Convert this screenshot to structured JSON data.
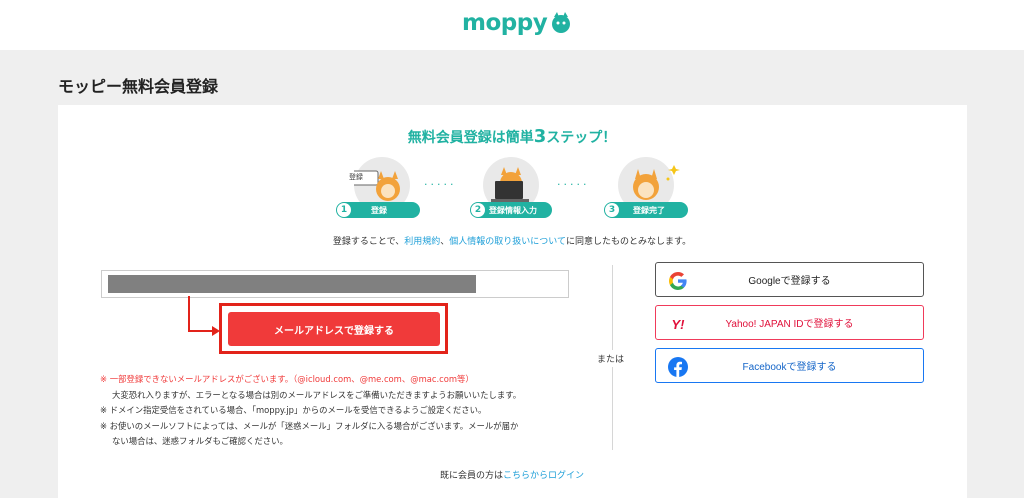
{
  "header": {
    "logo_text": "moppy"
  },
  "page_title": "モッピー無料会員登録",
  "steps": {
    "title_prefix": "無料会員登録は簡単",
    "title_num": "3",
    "title_suffix": "ステップ！",
    "items": [
      {
        "num": "1",
        "label": "登録",
        "card_text": "登録"
      },
      {
        "num": "2",
        "label": "登録情報入力"
      },
      {
        "num": "3",
        "label": "登録完了"
      }
    ],
    "dots": "·····"
  },
  "agreement": {
    "prefix": "登録することで、",
    "terms_link": "利用規約",
    "sep": "、",
    "privacy_link": "個人情報の取り扱いについて",
    "suffix": "に同意したものとみなします。"
  },
  "email_button_label": "メールアドレスで登録する",
  "notes": {
    "line1_mark": "※",
    "line1_red": "一部登録できないメールアドレスがございます。（@icloud.com、@me.com、@mac.com等）",
    "line1_cont": "大変恐れ入りますが、エラーとなる場合は別のメールアドレスをご準備いただきますようお願いいたします。",
    "line2": "※ ドメイン指定受信をされている場合、「moppy.jp」からのメールを受信できるようご設定ください。",
    "line3": "※ お使いのメールソフトによっては、メールが「迷惑メール」フォルダに入る場合がございます。メールが届か",
    "line3_cont": "ない場合は、迷惑フォルダもご確認ください。"
  },
  "or_text": "または",
  "sns": {
    "google_label": "Googleで登録する",
    "yahoo_label": "Yahoo! JAPAN IDで登録する",
    "yahoo_icon_text": "Y!",
    "facebook_label": "Facebookで登録する"
  },
  "login": {
    "prefix": "既に会員の方は",
    "link": "こちらからログイン"
  },
  "colors": {
    "brand": "#21b2a2",
    "cta": "#f03a3a",
    "link": "#1e9fd8",
    "highlight": "#e2231a"
  }
}
